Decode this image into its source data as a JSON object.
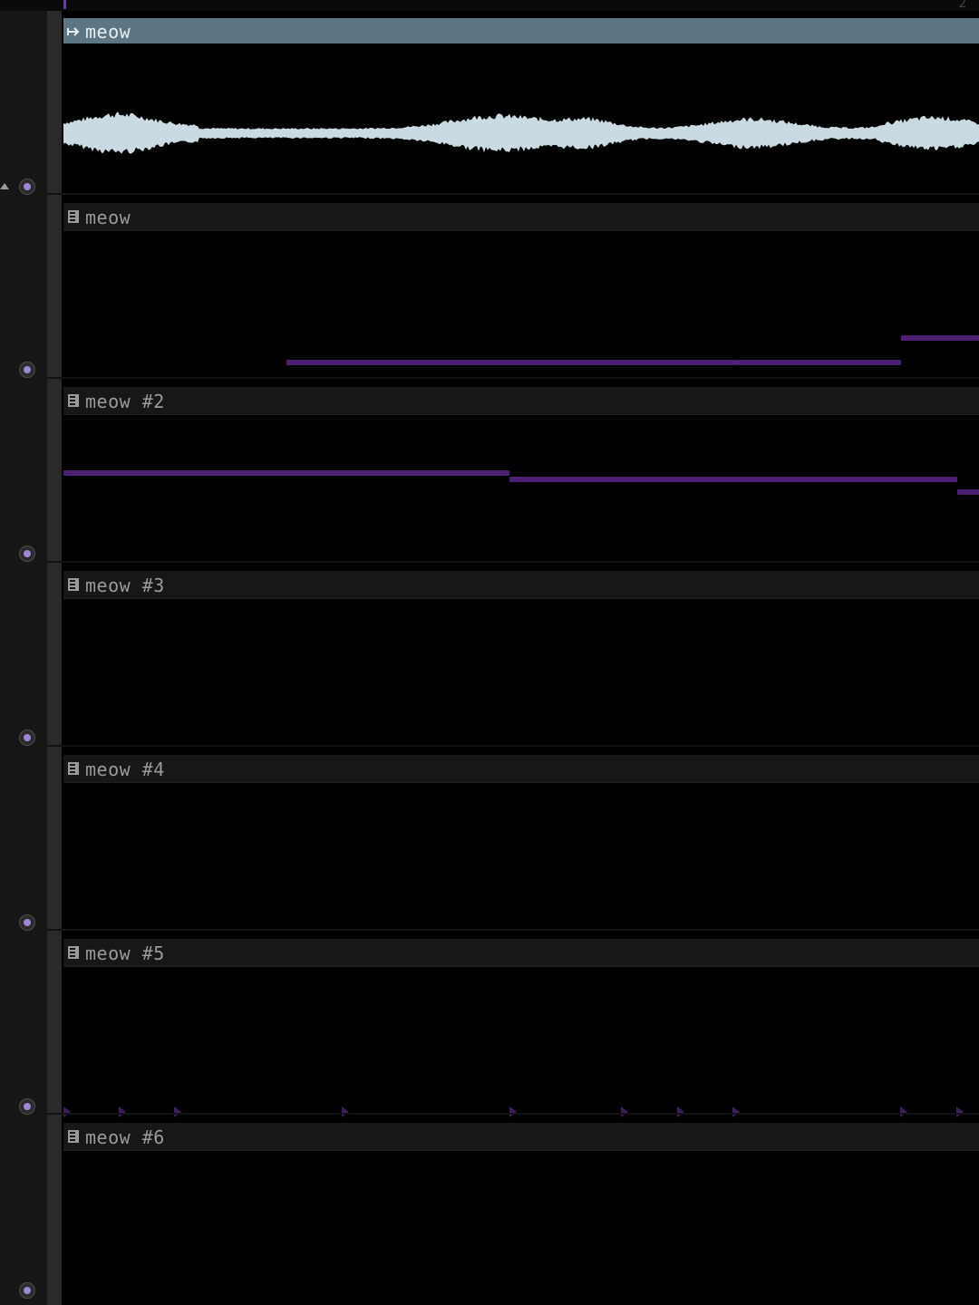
{
  "ruler": {
    "bar_label": "2"
  },
  "tracks": [
    {
      "clip_name": "meow",
      "clip_type": "audio",
      "icon": "audio-clip-icon"
    },
    {
      "clip_name": "meow",
      "clip_type": "pattern",
      "icon": "piano-roll-icon"
    },
    {
      "clip_name": "meow #2",
      "clip_type": "pattern",
      "icon": "piano-roll-icon"
    },
    {
      "clip_name": "meow #3",
      "clip_type": "pattern",
      "icon": "piano-roll-icon"
    },
    {
      "clip_name": "meow #4",
      "clip_type": "pattern",
      "icon": "piano-roll-icon"
    },
    {
      "clip_name": "meow #5",
      "clip_type": "pattern",
      "icon": "piano-roll-icon"
    },
    {
      "clip_name": "meow #6",
      "clip_type": "pattern",
      "icon": "piano-roll-icon"
    }
  ],
  "colors": {
    "audio_clip_header": "#5d7684",
    "waveform": "#c9dae3",
    "note": "#4c1f72",
    "knob_center": "#9f86d6"
  }
}
